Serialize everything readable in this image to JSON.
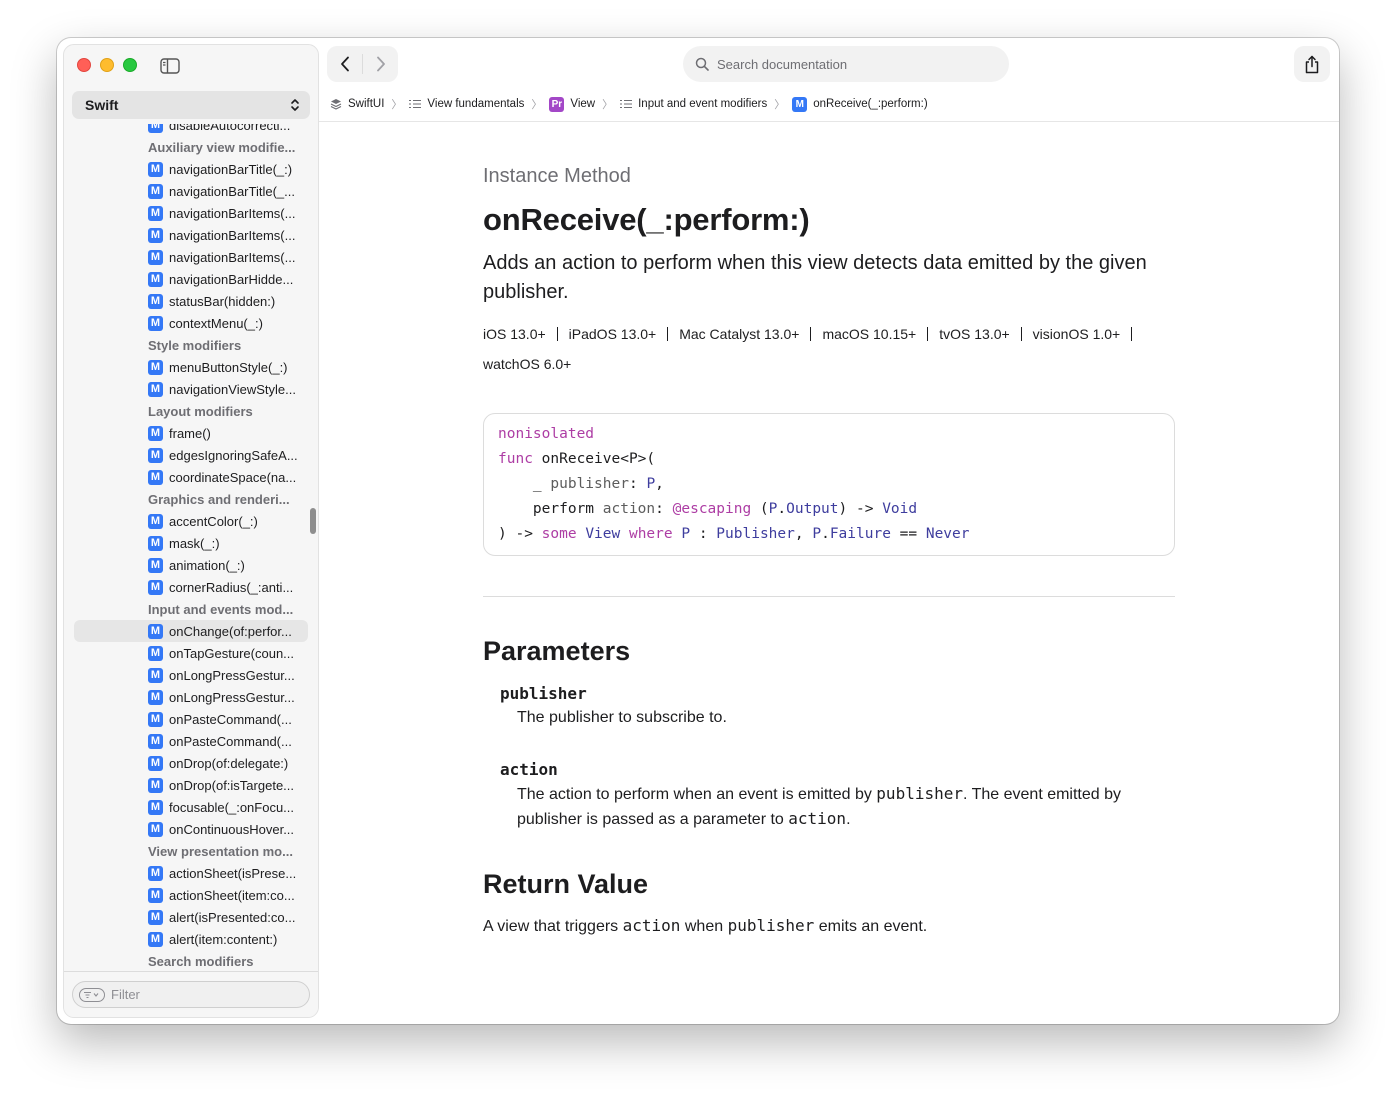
{
  "sidebar": {
    "language": "Swift",
    "filter_placeholder": "Filter",
    "items": [
      {
        "type": "method",
        "label": "disableAutocorrecti..."
      },
      {
        "type": "header",
        "label": "Auxiliary view modifie..."
      },
      {
        "type": "method",
        "label": "navigationBarTitle(_:)"
      },
      {
        "type": "method",
        "label": "navigationBarTitle(_..."
      },
      {
        "type": "method",
        "label": "navigationBarItems(..."
      },
      {
        "type": "method",
        "label": "navigationBarItems(..."
      },
      {
        "type": "method",
        "label": "navigationBarItems(..."
      },
      {
        "type": "method",
        "label": "navigationBarHidde..."
      },
      {
        "type": "method",
        "label": "statusBar(hidden:)"
      },
      {
        "type": "method",
        "label": "contextMenu(_:)"
      },
      {
        "type": "header",
        "label": "Style modifiers"
      },
      {
        "type": "method",
        "label": "menuButtonStyle(_:)"
      },
      {
        "type": "method",
        "label": "navigationViewStyle..."
      },
      {
        "type": "header",
        "label": "Layout modifiers"
      },
      {
        "type": "method",
        "label": "frame()"
      },
      {
        "type": "method",
        "label": "edgesIgnoringSafeA..."
      },
      {
        "type": "method",
        "label": "coordinateSpace(na..."
      },
      {
        "type": "header",
        "label": "Graphics and renderi..."
      },
      {
        "type": "method",
        "label": "accentColor(_:)"
      },
      {
        "type": "method",
        "label": "mask(_:)"
      },
      {
        "type": "method",
        "label": "animation(_:)"
      },
      {
        "type": "method",
        "label": "cornerRadius(_:anti..."
      },
      {
        "type": "header",
        "label": "Input and events mod..."
      },
      {
        "type": "method",
        "label": "onChange(of:perfor...",
        "selected": true
      },
      {
        "type": "method",
        "label": "onTapGesture(coun..."
      },
      {
        "type": "method",
        "label": "onLongPressGestur..."
      },
      {
        "type": "method",
        "label": "onLongPressGestur..."
      },
      {
        "type": "method",
        "label": "onPasteCommand(..."
      },
      {
        "type": "method",
        "label": "onPasteCommand(..."
      },
      {
        "type": "method",
        "label": "onDrop(of:delegate:)"
      },
      {
        "type": "method",
        "label": "onDrop(of:isTargete..."
      },
      {
        "type": "method",
        "label": "focusable(_:onFocu..."
      },
      {
        "type": "method",
        "label": "onContinuousHover..."
      },
      {
        "type": "header",
        "label": "View presentation mo..."
      },
      {
        "type": "method",
        "label": "actionSheet(isPrese..."
      },
      {
        "type": "method",
        "label": "actionSheet(item:co..."
      },
      {
        "type": "method",
        "label": "alert(isPresented:co..."
      },
      {
        "type": "method",
        "label": "alert(item:content:)"
      },
      {
        "type": "header",
        "label": "Search modifiers"
      }
    ],
    "badge_letter": "M"
  },
  "toolbar": {
    "search_placeholder": "Search documentation"
  },
  "breadcrumb": [
    {
      "label": "SwiftUI",
      "icon": "framework-icon"
    },
    {
      "label": "View fundamentals",
      "icon": "list-icon"
    },
    {
      "label": "View",
      "icon": "protocol-badge",
      "badge": "Pr"
    },
    {
      "label": "Input and event modifiers",
      "icon": "list-icon"
    },
    {
      "label": "onReceive(_:perform:)",
      "icon": "method-badge",
      "badge": "M"
    }
  ],
  "content": {
    "kind": "Instance Method",
    "title": "onReceive(_:perform:)",
    "abstract": "Adds an action to perform when this view detects data emitted by the given publisher.",
    "platforms": [
      "iOS 13.0+",
      "iPadOS 13.0+",
      "Mac Catalyst 13.0+",
      "macOS 10.15+",
      "tvOS 13.0+",
      "visionOS 1.0+",
      "watchOS 6.0+"
    ],
    "parameters_heading": "Parameters",
    "parameters": [
      {
        "name": "publisher",
        "description_parts": [
          "The publisher to subscribe to."
        ]
      },
      {
        "name": "action",
        "description_parts": [
          "The action to perform when an event is emitted by ",
          "publisher",
          ". The event emitted by publisher is passed as a parameter to ",
          "action",
          "."
        ]
      }
    ],
    "return_heading": "Return Value",
    "return_parts": [
      "A view that triggers ",
      "action",
      " when ",
      "publisher",
      " emits an event."
    ]
  },
  "code": {
    "l1_kw": "nonisolated",
    "l2_kw": "func",
    "l2_rest": " onReceive<P>(",
    "l3_a": "    _ ",
    "l3_b": "publisher",
    "l3_c": ": ",
    "l3_d": "P",
    "l3_e": ",",
    "l4_a": "    perform ",
    "l4_b": "action",
    "l4_c": ": ",
    "l4_d": "@escaping",
    "l4_e": " (",
    "l4_f": "P",
    "l4_g": ".",
    "l4_h": "Output",
    "l4_i": ") -> ",
    "l4_j": "Void",
    "l5_a": ") -> ",
    "l5_b": "some",
    "l5_c": " ",
    "l5_d": "View",
    "l5_e": " ",
    "l5_f": "where",
    "l5_g": " ",
    "l5_h": "P",
    "l5_i": " : ",
    "l5_j": "Publisher",
    "l5_k": ", ",
    "l5_l": "P",
    "l5_m": ".",
    "l5_n": "Failure",
    "l5_o": " == ",
    "l5_p": "Never"
  }
}
